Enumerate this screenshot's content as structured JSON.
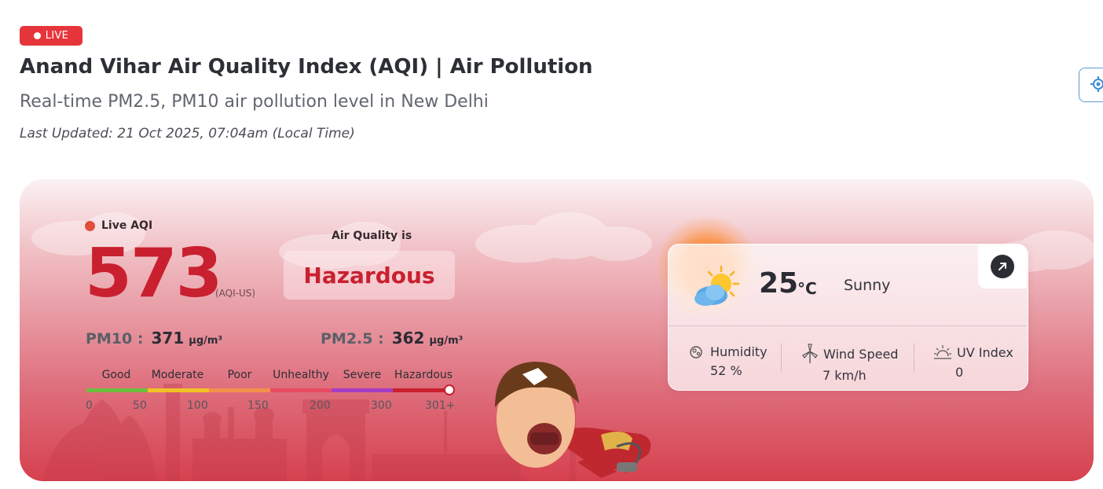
{
  "header": {
    "live_badge": "LIVE",
    "title": "Anand Vihar Air Quality Index (AQI) | Air Pollution",
    "subtitle": "Real-time PM2.5, PM10 air pollution level in New Delhi",
    "last_updated": "Last Updated: 21 Oct 2025, 07:04am (Local Time)",
    "locate_icon": "locate-icon"
  },
  "aqi": {
    "live_label": "Live AQI",
    "value": "573",
    "unit": "(AQI-US)",
    "air_quality_label": "Air Quality is",
    "status": "Hazardous",
    "status_color": "#c9202f",
    "pm10": {
      "label": "PM10 :",
      "value": "371",
      "unit": "µg/m³"
    },
    "pm25": {
      "label": "PM2.5 :",
      "value": "362",
      "unit": "µg/m³"
    },
    "scale": {
      "categories": [
        "Good",
        "Moderate",
        "Poor",
        "Unhealthy",
        "Severe",
        "Hazardous"
      ],
      "ticks": [
        "0",
        "50",
        "100",
        "150",
        "200",
        "300",
        "301+"
      ],
      "colors": [
        "#6cbf3c",
        "#f2c224",
        "#f2914a",
        "#e84a63",
        "#a73cc6",
        "#c9202f"
      ]
    }
  },
  "weather": {
    "icon": "partly-sunny-icon",
    "temperature": "25",
    "temperature_unit": "°C",
    "condition": "Sunny",
    "open_icon": "arrow-up-right-icon",
    "humidity": {
      "label": "Humidity",
      "value": "52 %",
      "icon": "humidity-icon"
    },
    "wind": {
      "label": "Wind Speed",
      "value": "7 km/h",
      "icon": "wind-turbine-icon"
    },
    "uv": {
      "label": "UV Index",
      "value": "0",
      "icon": "uv-sun-icon"
    }
  },
  "colors": {
    "accent_red": "#e5353b",
    "hazard_red": "#c9202f"
  }
}
